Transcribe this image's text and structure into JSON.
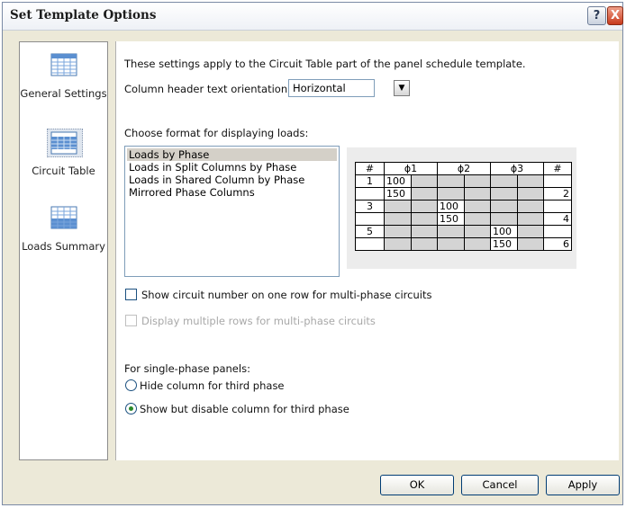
{
  "window": {
    "title": "Set Template Options",
    "help_label": "?",
    "close_label": "X"
  },
  "sidebar": {
    "items": [
      {
        "label": "General Settings",
        "icon": "general-settings-icon"
      },
      {
        "label": "Circuit Table",
        "icon": "circuit-table-icon",
        "selected": true
      },
      {
        "label": "Loads Summary",
        "icon": "loads-summary-icon"
      }
    ]
  },
  "main": {
    "intro": "These settings apply to the Circuit Table part of the panel schedule template.",
    "orientation_label": "Column header text orientation:",
    "orientation_value": "Horizontal",
    "format_label": "Choose format for displaying loads:",
    "formats": [
      "Loads by Phase",
      "Loads in Split Columns by Phase",
      "Loads in Shared Column by Phase",
      "Mirrored Phase Columns"
    ],
    "selected_format": "Loads by Phase",
    "preview": {
      "headers": [
        "#",
        "ϕ1",
        "ϕ2",
        "ϕ3",
        "#"
      ],
      "rows": [
        [
          "1",
          "100",
          "",
          "",
          "",
          "",
          "",
          ""
        ],
        [
          "",
          "150",
          "",
          "",
          "",
          "",
          "",
          "2"
        ],
        [
          "3",
          "",
          "",
          "100",
          "",
          "",
          "",
          ""
        ],
        [
          "",
          "",
          "",
          "150",
          "",
          "",
          "",
          "4"
        ],
        [
          "5",
          "",
          "",
          "",
          "",
          "100",
          "",
          ""
        ],
        [
          "",
          "",
          "",
          "",
          "",
          "150",
          "",
          "6"
        ]
      ]
    },
    "show_circuit_number_label": "Show circuit number on one row for multi-phase circuits",
    "show_circuit_number_checked": false,
    "multi_rows_label": "Display multiple rows for multi-phase circuits",
    "multi_rows_enabled": false,
    "single_phase_label": "For single-phase panels:",
    "radio_hide_label": "Hide column for third phase",
    "radio_show_label": "Show but disable column for third phase",
    "radio_selected": "show"
  },
  "buttons": {
    "ok": "OK",
    "cancel": "Cancel",
    "apply": "Apply"
  },
  "colors": {
    "dialog_bg": "#ece9d8",
    "selection_gray": "#d4d0c8",
    "radio_dot": "#2b8a2b"
  }
}
